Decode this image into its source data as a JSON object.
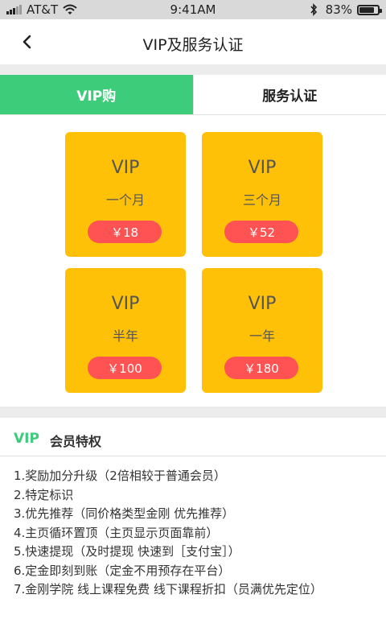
{
  "status_bar": {
    "carrier": "AT&T",
    "time": "9:41AM",
    "battery_percent": "83%",
    "battery_level": 0.83,
    "signal_bars_filled": 3,
    "signal_bars_total": 5
  },
  "header": {
    "title": "VIP及服务认证",
    "back_icon": "chevron-left-icon"
  },
  "tabs": [
    {
      "label": "VIP购",
      "active": true
    },
    {
      "label": "服务认证",
      "active": false
    }
  ],
  "plans": [
    {
      "vip": "VIP",
      "period": "一个月",
      "price": "￥18"
    },
    {
      "vip": "VIP",
      "period": "三个月",
      "price": "￥52"
    },
    {
      "vip": "VIP",
      "period": "半年",
      "price": "￥100"
    },
    {
      "vip": "VIP",
      "period": "一年",
      "price": "￥180"
    }
  ],
  "privileges": {
    "vip_label": "VIP",
    "title": "会员特权",
    "items": [
      "1.奖励加分升级（2倍相较于普通会员）",
      "2.特定标识",
      "3.优先推荐（同价格类型金刚 优先推荐）",
      "4.主页循环置顶（主页显示页面靠前）",
      "5.快速提现（及时提现 快速到［支付宝］）",
      "6.定金即刻到账（定金不用预存在平台）",
      "7.金刚学院 线上课程免费 线下课程折扣（员满优先定位）"
    ]
  },
  "colors": {
    "accent_green": "#3dcc7a",
    "card_yellow": "#ffc107",
    "price_red": "#ff5252"
  }
}
